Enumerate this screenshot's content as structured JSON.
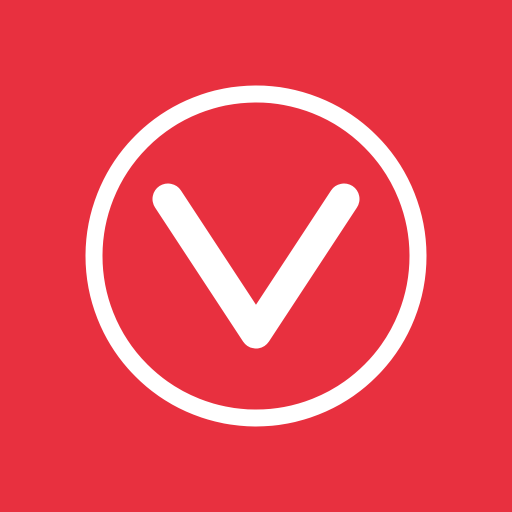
{
  "icon": {
    "name": "chevron-down-circle-icon",
    "background_color": "#E8303F",
    "foreground_color": "#FFFFFF"
  }
}
